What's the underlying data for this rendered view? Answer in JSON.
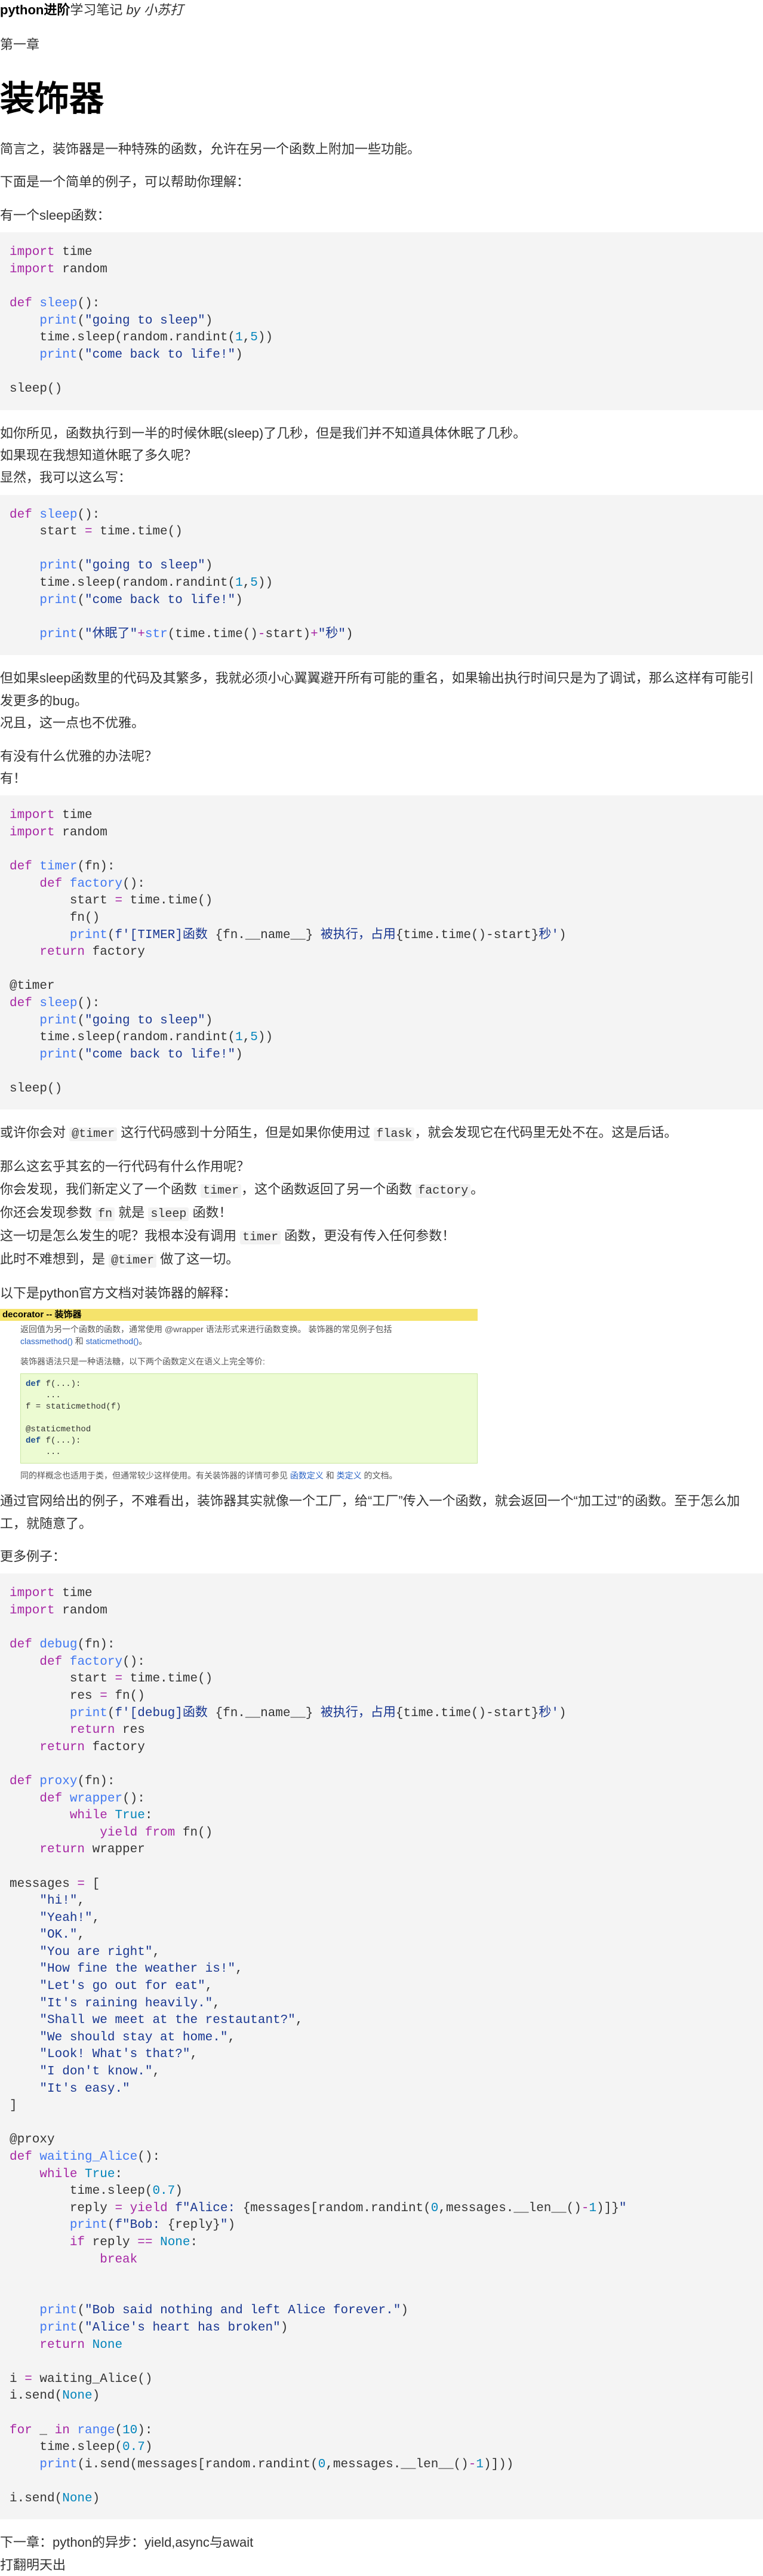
{
  "header": {
    "bold": "python进阶",
    "rest": "学习笔记",
    "author": "by 小苏打"
  },
  "chapter": "第一章",
  "title": "装饰器",
  "intro": [
    "简言之，装饰器是一种特殊的函数，允许在另一个函数上附加一些功能。",
    "下面是一个简单的例子，可以帮助你理解：",
    "有一个sleep函数："
  ],
  "mid1": [
    "如你所见，函数执行到一半的时候休眠(sleep)了几秒，但是我们并不知道具体休眠了几秒。",
    "如果现在我想知道休眠了多久呢？",
    "显然，我可以这么写："
  ],
  "mid2": [
    "但如果sleep函数里的代码及其繁多，我就必须小心翼翼避开所有可能的重名，如果输出执行时间只是为了调试，那么这样有可能引发更多的bug。",
    "况且，这一点也不优雅。"
  ],
  "mid3": [
    "有没有什么优雅的办法呢？",
    "有！"
  ],
  "after3": {
    "a1": "或许你会对 ",
    "c1": "@timer",
    "a2": " 这行代码感到十分陌生，但是如果你使用过 ",
    "c2": "flask",
    "a3": "，就会发现它在代码里无处不在。这是后话。"
  },
  "q": {
    "l1": "那么这玄乎其玄的一行代码有什么作用呢？",
    "l2a": "你会发现，我们新定义了一个函数 ",
    "l2c": "timer",
    "l2b": "，这个函数返回了另一个函数 ",
    "l2d": "factory",
    "l2e": "。",
    "l3a": "你还会发现参数 ",
    "l3c": "fn",
    "l3b": " 就是 ",
    "l3d": "sleep",
    "l3e": " 函数！",
    "l4a": "这一切是怎么发生的呢？我根本没有调用 ",
    "l4c": "timer",
    "l4b": " 函数，更没有传入任何参数！",
    "l5a": "此时不难想到，是 ",
    "l5c": "@timer",
    "l5b": " 做了这一切。"
  },
  "doc_intro": "以下是python官方文档对装饰器的解释：",
  "docbox": {
    "title": "decorator -- 装饰器",
    "line1": "返回值为另一个函数的函数，通常使用 @wrapper 语法形式来进行函数变换。 装饰器的常见例子包括",
    "line1b": "classmethod()",
    "line1c": " 和 ",
    "line1d": "staticmethod()",
    "line1e": "。",
    "line2": "装饰器语法只是一种语法糖，以下两个函数定义在语义上完全等价:",
    "line3a": "同的样概念也适用于类，但通常较少这样使用。有关装饰器的详情可参见 ",
    "line3b": "函数定义",
    "line3c": " 和 ",
    "line3d": "类定义",
    "line3e": " 的文档。"
  },
  "after_doc": "通过官网给出的例子，不难看出，装饰器其实就像一个工厂，给“工厂”传入一个函数，就会返回一个“加工过”的函数。至于怎么加工，就随意了。",
  "more": "更多例子：",
  "footer": {
    "next": "下一章：python的异步：yield,async与await",
    "sign": "打翻明天出"
  }
}
